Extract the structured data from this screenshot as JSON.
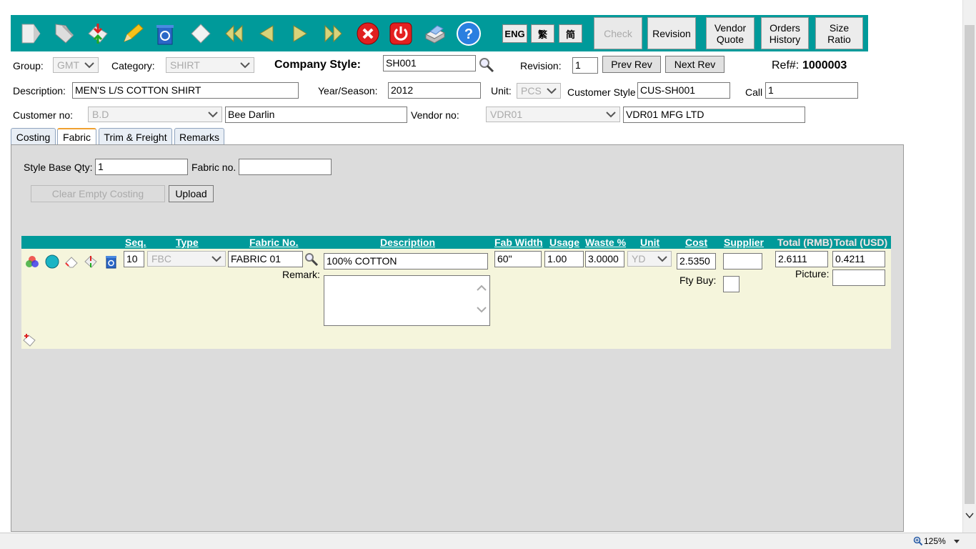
{
  "toolbar": {
    "icons": [
      "new-doc-icon",
      "tag-icon",
      "transfer-icon",
      "edit-pencil-icon",
      "recycle-bin-icon",
      "eraser-icon",
      "first-record-icon",
      "previous-record-icon",
      "next-record-icon",
      "last-record-icon",
      "cancel-icon",
      "power-icon",
      "print-icon",
      "help-icon"
    ],
    "lang_eng": "ENG",
    "lang_trad": "繁",
    "lang_simp": "简",
    "check_label": "Check",
    "revision_label": "Revision",
    "vendor_quote_l1": "Vendor",
    "vendor_quote_l2": "Quote",
    "orders_history_l1": "Orders",
    "orders_history_l2": "History",
    "size_ratio_l1": "Size",
    "size_ratio_l2": "Ratio"
  },
  "header": {
    "group_label": "Group:",
    "group_value": "GMT",
    "category_label": "Category:",
    "category_value": "SHIRT",
    "company_style_label": "Company Style:",
    "company_style_value": "SH001",
    "revision_label": "Revision:",
    "revision_value": "1",
    "prev_rev_label": "Prev Rev",
    "next_rev_label": "Next Rev",
    "ref_label": "Ref#:",
    "ref_value": "1000003",
    "description_label": "Description:",
    "description_value": "MEN'S L/S COTTON SHIRT",
    "year_season_label": "Year/Season:",
    "year_season_value": "2012",
    "unit_label": "Unit:",
    "unit_value": "PCS",
    "customer_style_label": "Customer Style",
    "customer_style_value": "CUS-SH001",
    "call_label": "Call",
    "call_value": "1",
    "customer_no_label": "Customer no:",
    "customer_no_value": "B.D",
    "customer_name": "Bee Darlin",
    "vendor_no_label": "Vendor no:",
    "vendor_no_value": "VDR01",
    "vendor_name": "VDR01 MFG LTD"
  },
  "tabs": [
    "Costing",
    "Fabric",
    "Trim & Freight",
    "Remarks"
  ],
  "active_tab": "Fabric",
  "fabric": {
    "style_base_qty_label": "Style Base Qty:",
    "style_base_qty_value": "1",
    "fabric_no_label": "Fabric no.",
    "fabric_no_value": "",
    "clear_empty_costing_label": "Clear Empty Costing",
    "upload_label": "Upload",
    "columns": {
      "seq": "Seq.",
      "type": "Type",
      "fabric_no": "Fabric No.",
      "description": "Description",
      "fab_width": "Fab Width",
      "usage": "Usage",
      "waste": "Waste %",
      "unit": "Unit",
      "cost": "Cost",
      "supplier": "Supplier",
      "total_rmb": "Total (RMB)",
      "total_usd": "Total (USD)"
    },
    "row": {
      "row_icons": [
        "color-wheel-icon",
        "cyan-dot-icon",
        "eraser-icon",
        "transfer-icon",
        "recycle-bin-icon"
      ],
      "seq": "10",
      "type": "FBC",
      "fabric_no": "FABRIC 01",
      "description": "100% COTTON",
      "remark_label": "Remark:",
      "remark_value": "",
      "fab_width": "60\"",
      "usage": "1.00",
      "waste": "3.0000",
      "unit": "YD",
      "cost": "2.5350",
      "supplier": "",
      "fty_buy_label": "Fty Buy:",
      "total_rmb": "2.6111",
      "total_usd": "0.4211",
      "picture_label": "Picture:",
      "picture_value": ""
    },
    "add_row_icon": "add-row-icon"
  },
  "status": {
    "zoom": "125%"
  },
  "colors": {
    "toolbar_bg": "#009a9a",
    "panel_bg": "#dcdcdc",
    "row_bg": "#f5f5dc",
    "header_bg": "#009a9a"
  }
}
